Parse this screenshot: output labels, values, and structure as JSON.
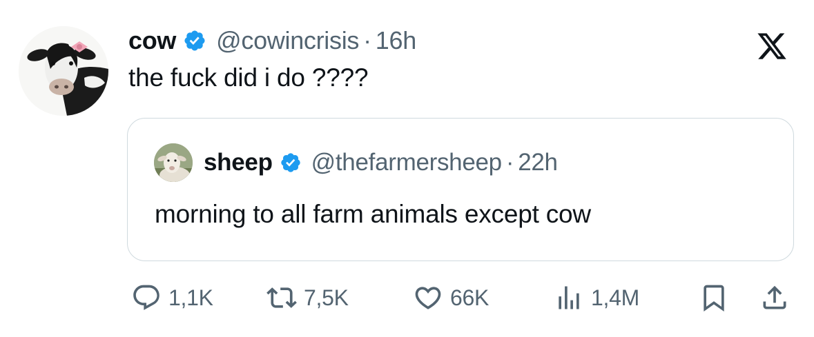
{
  "post": {
    "author": {
      "display_name": "cow",
      "handle": "@cowincrisis",
      "separator": "·",
      "time": "16h",
      "verified_icon": "verified-badge-icon",
      "avatar": "cow-avatar"
    },
    "text": "the fuck did i do ????",
    "brand_icon": "x-logo-icon"
  },
  "quote": {
    "author": {
      "display_name": "sheep",
      "handle": "@thefarmersheep",
      "separator": "·",
      "time": "22h",
      "verified_icon": "verified-badge-icon",
      "avatar": "sheep-avatar"
    },
    "text": "morning to all farm animals except cow"
  },
  "actions": {
    "reply": {
      "icon": "reply-icon",
      "count": "1,1K"
    },
    "repost": {
      "icon": "repost-icon",
      "count": "7,5K"
    },
    "like": {
      "icon": "heart-icon",
      "count": "66K"
    },
    "views": {
      "icon": "views-icon",
      "count": "1,4M"
    },
    "bookmark": {
      "icon": "bookmark-icon"
    },
    "share": {
      "icon": "share-icon"
    }
  },
  "colors": {
    "text": "#0f1419",
    "muted": "#536471",
    "verified": "#1d9bf0",
    "border": "#cfd9de"
  }
}
